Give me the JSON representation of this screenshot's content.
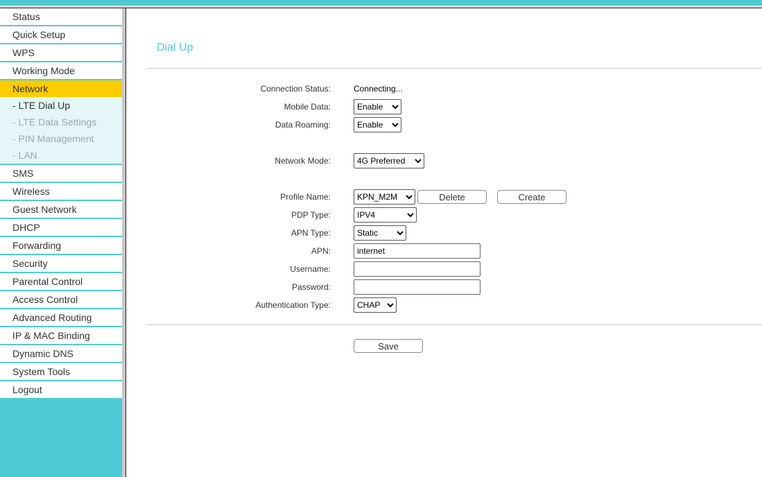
{
  "sidebar": {
    "items": [
      "Status",
      "Quick Setup",
      "WPS",
      "Working Mode",
      "Network"
    ],
    "sub": [
      "- LTE Dial Up",
      "- LTE Data Settings",
      "- PIN Management",
      "- LAN"
    ],
    "items2": [
      "SMS",
      "Wireless",
      "Guest Network",
      "DHCP",
      "Forwarding",
      "Security",
      "Parental Control",
      "Access Control",
      "Advanced Routing",
      "IP & MAC Binding",
      "Dynamic DNS",
      "System Tools",
      "Logout"
    ]
  },
  "page": {
    "title": "Dial Up",
    "connection_status_label": "Connection Status:",
    "connection_status": "Connecting...",
    "mobile_data_label": "Mobile Data:",
    "mobile_data": "Enable",
    "data_roaming_label": "Data Roaming:",
    "data_roaming": "Enable",
    "network_mode_label": "Network Mode:",
    "network_mode": "4G Preferred",
    "profile_name_label": "Profile Name:",
    "profile_name": "KPN_M2M",
    "delete": "Delete",
    "create": "Create",
    "pdp_type_label": "PDP Type:",
    "pdp_type": "IPV4",
    "apn_type_label": "APN Type:",
    "apn_type": "Static",
    "apn_label": "APN:",
    "apn": "internet",
    "username_label": "Username:",
    "username": "",
    "password_label": "Password:",
    "password": "",
    "auth_type_label": "Authentication Type:",
    "auth_type": "CHAP",
    "save": "Save"
  }
}
